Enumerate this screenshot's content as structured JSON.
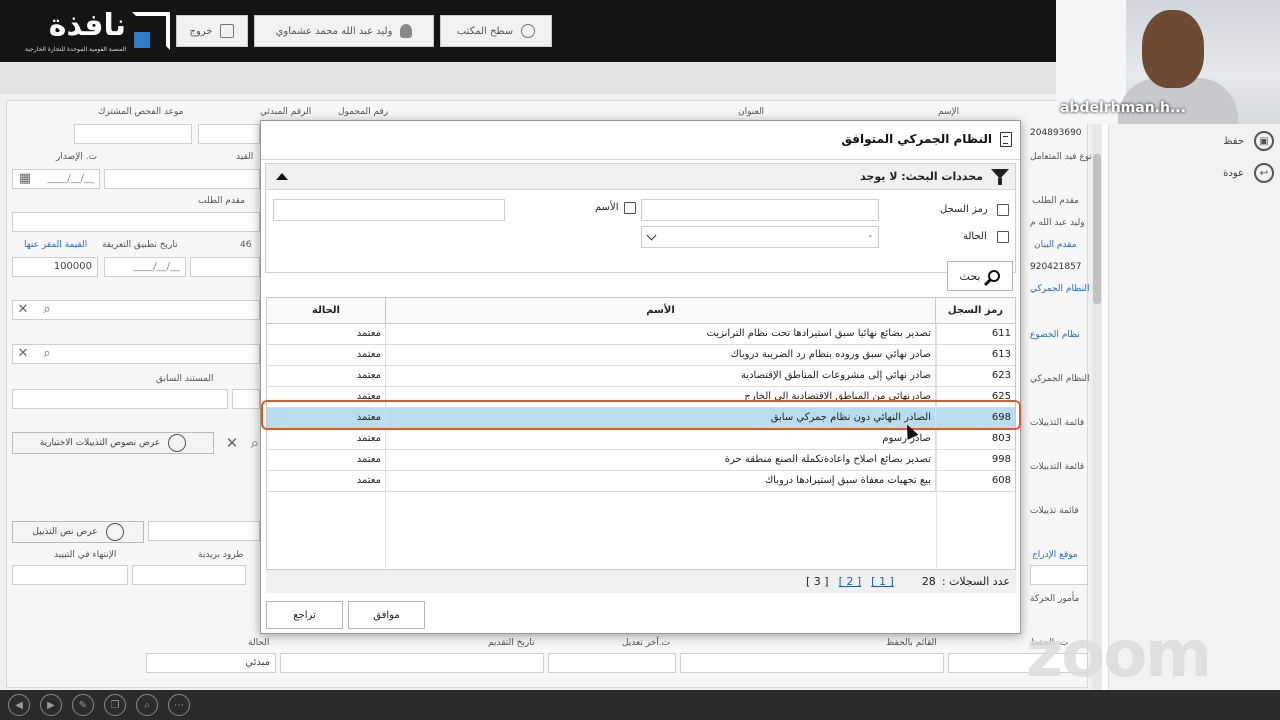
{
  "header": {
    "logo_text": "نافذة",
    "logo_tagline": "المنصة القومية الموحدة للتجارة الخارجية",
    "exit_label": "خروج",
    "user_name": "وليد عبد الله محمد عشماوي",
    "desktop_label": "سطح المكتب"
  },
  "zoom": {
    "participant": "abdelrhman.h...",
    "brand": "zoom"
  },
  "right_panel": {
    "save_label": "حفظ",
    "back_label": "عودة"
  },
  "background_form": {
    "labels": {
      "name": "الإسم",
      "address": "العنوان",
      "carrier_no": "رقم المحمول",
      "initial_no": "الرقم المبدئي",
      "joint_exam_date": "موعد الفحص المشترك",
      "request_type": "نوع قيد المتعامل",
      "registration": "القيد",
      "issue_date": "ت. الإصدار",
      "applicant": "مقدم الطلب",
      "applicant2": "مقدم الطلب",
      "tariff_date": "تاريخ تطبيق التعريفة",
      "declared_value": "القيمة المقر عنها",
      "data_provider": "مقدم البيان",
      "customs_system": "النظام الجمركي",
      "subject_system": "نظام الخضوع",
      "customs_system2": "النظام الجمركي",
      "prev_document": "المستند السابق",
      "amendments_list": "قائمة التذييلات",
      "amendments_list2": "قائمة التذييلات",
      "amendments_list3": "قائمة تذييلات",
      "insert_location": "موقع الإدراج",
      "movement_officer": "مأمور الحركة",
      "postal_parcels": "طرود بريدية",
      "end_in_amendment": "الإنتهاء في التبييد",
      "status": "الحالة",
      "submit_date": "تاريخ التقديم",
      "last_modified": "ت.آخر تعديل",
      "saved_by": "القائم بالحفظ",
      "saved_date": "ت. الحفظ"
    },
    "values": {
      "request_no": "204893690",
      "applicant_name": "وليد عبد الله م",
      "provider_no": "920421857",
      "tariff_code": "46",
      "declared_amount": "100000",
      "status_value": "مبدئي"
    },
    "buttons": {
      "show_optional_amendments": "عرض نصوص التذييلات الاختيارية",
      "show_amendment_text": "عرض نص التذييل"
    }
  },
  "dialog": {
    "title": "النظام الجمركي المتوافق",
    "criteria": {
      "header": "محددات البحث: لا يوجد",
      "record_code_label": "رمز السجل",
      "name_label": "الأسم",
      "status_label": "الحالة",
      "status_select_value": "-"
    },
    "search_label": "بحث",
    "columns": {
      "code": "رمز السجل",
      "name": "الأسم",
      "status": "الحالة"
    },
    "rows": [
      {
        "code": "611",
        "name": "تصدير بضائع نهائيا سبق استيرادها تحت نظام الترانزيت",
        "status": "معتمد"
      },
      {
        "code": "613",
        "name": "صادر نهائي سبق وروده بنظام رد الضريبة دروباك",
        "status": "معتمد"
      },
      {
        "code": "623",
        "name": "صادر نهائي إلى مشروعات المناطق الإقتصادية",
        "status": "معتمد"
      },
      {
        "code": "625",
        "name": "صادرنهائي من المناطق الاقتصادية الى الخارج",
        "status": "معتمد"
      },
      {
        "code": "698",
        "name": "الصادر النهائي دون نظام جمركي سابق",
        "status": "معتمد"
      },
      {
        "code": "803",
        "name": "صادر رسوم",
        "status": "معتمد"
      },
      {
        "code": "998",
        "name": "تصدير بضائع اصلاح واعادةتكملة الصنع منطقة حرة",
        "status": "معتمد"
      },
      {
        "code": "608",
        "name": "بيع تجهيات معفاة سبق إستيرادها دروباك",
        "status": "معتمد"
      }
    ],
    "selected_index": 4,
    "pager": {
      "count_label": "عدد السجلات :",
      "count_value": "28",
      "pages": [
        "[ 3 ]",
        "[ 2 ]",
        "[ 1 ]"
      ]
    },
    "ok_label": "موافق",
    "cancel_label": "تراجع"
  },
  "colors": {
    "topbar": "#141414",
    "selected_row": "#b9dcee",
    "selection_ring": "#e25a1e",
    "link": "#2a6fb5"
  }
}
